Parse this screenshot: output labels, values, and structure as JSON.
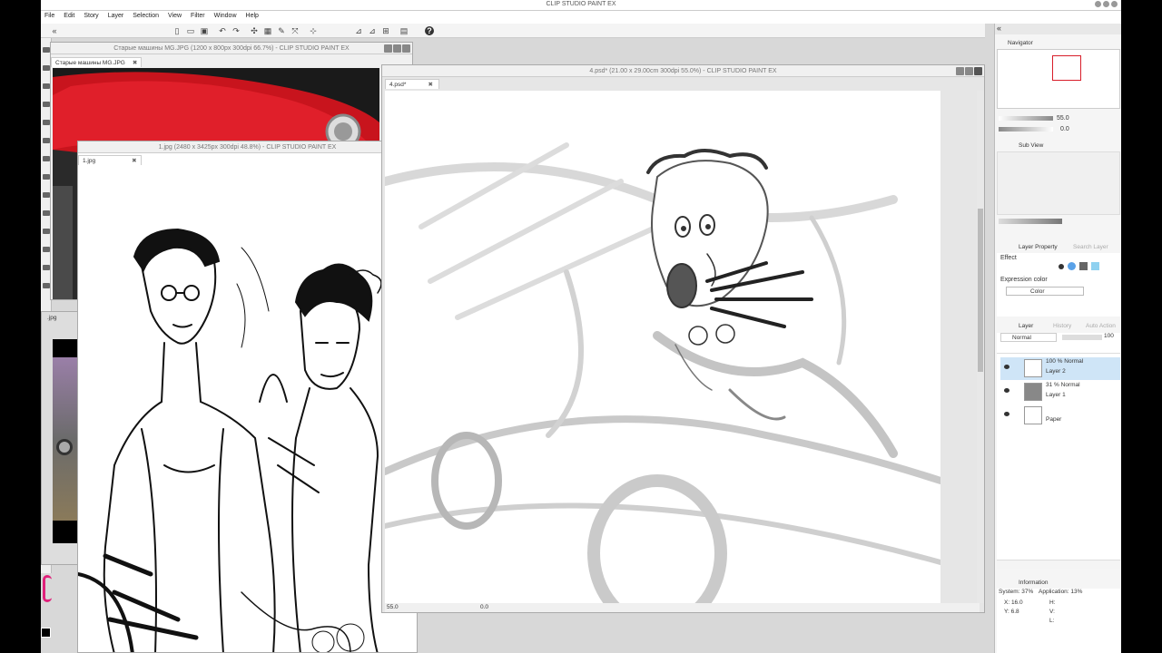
{
  "app": {
    "title": "CLIP STUDIO PAINT EX"
  },
  "menu": [
    "File",
    "Edit",
    "Story",
    "Layer",
    "Selection",
    "View",
    "Filter",
    "Window",
    "Help"
  ],
  "docs": {
    "cars": {
      "title": "Старые машины MG.JPG (1200 x 800px 300dpi 66.7%)  -  CLIP STUDIO PAINT EX",
      "tab": "Старые машины MG.JPG"
    },
    "one": {
      "title": "1.jpg (2480 x 3425px 300dpi 48.8%)  -  CLIP STUDIO PAINT EX",
      "tab": "1.jpg"
    },
    "main": {
      "title": "4.psd* (21.00 x 29.00cm 300dpi 55.0%)  -  CLIP STUDIO PAINT EX",
      "tab": "4.psd*",
      "zoom": "55.0",
      "angle": "0.0"
    },
    "hidden_tab": ".jpg"
  },
  "navigator": {
    "tab": "Navigator",
    "zoom": "55.0",
    "angle": "0.0"
  },
  "subview": {
    "tab": "Sub View"
  },
  "layer_property": {
    "tab": "Layer Property",
    "tab2": "Search Layer",
    "effect_label": "Effect",
    "expression_label": "Expression color",
    "expression_value": "Color"
  },
  "layers_panel": {
    "tab": "Layer",
    "tab2": "History",
    "tab3": "Auto Action",
    "blend_mode": "Normal",
    "opacity": "100",
    "layers": [
      {
        "opacity": "100 %",
        "mode": "Normal",
        "name": "Layer 2",
        "selected": true
      },
      {
        "opacity": "31 %",
        "mode": "Normal",
        "name": "Layer 1",
        "selected": false
      },
      {
        "opacity": "",
        "mode": "",
        "name": "Paper",
        "selected": false
      }
    ]
  },
  "information": {
    "tab": "Information",
    "system": "System: 37%",
    "application": "Application: 13%",
    "x": "X: 16.0",
    "y": "Y: 6.8",
    "h": "H:",
    "v": "V:",
    "l": "L:"
  },
  "colors": {
    "accent_red": "#d81e2a",
    "selection": "#cfe5f7"
  }
}
